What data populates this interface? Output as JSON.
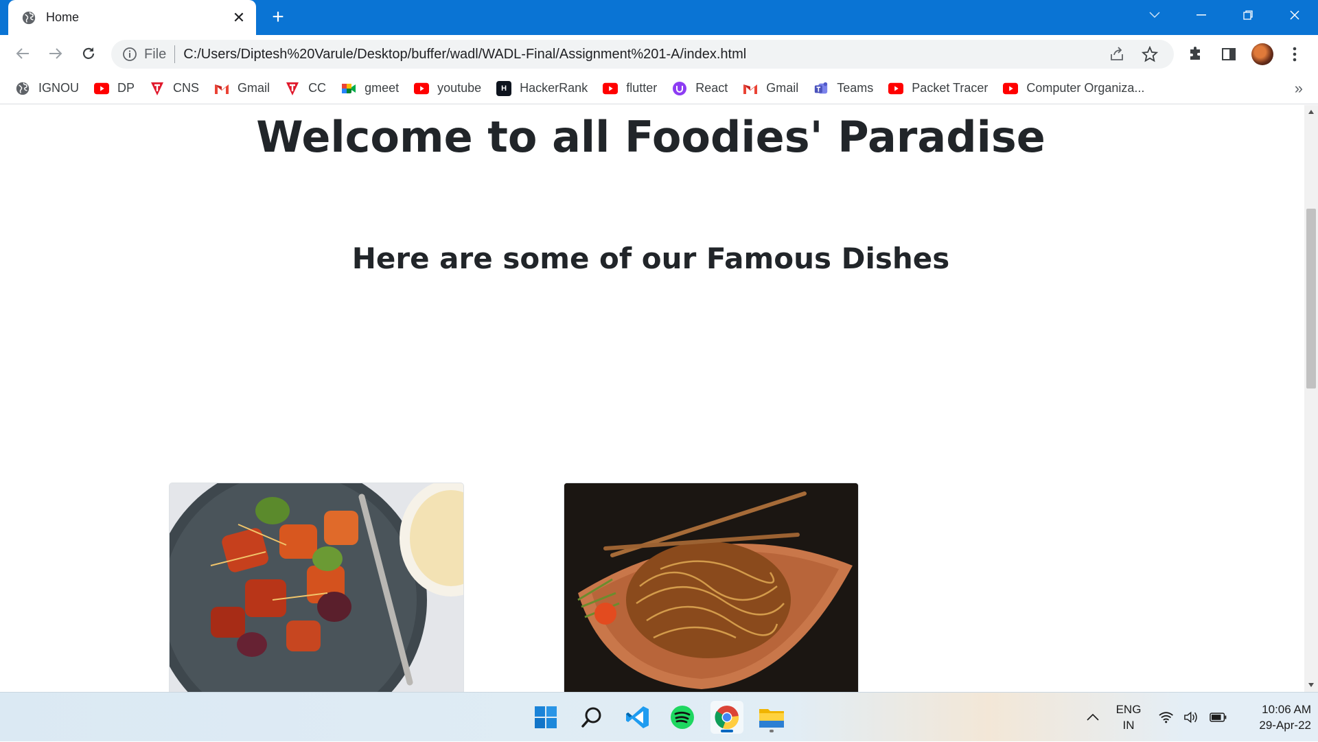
{
  "browser": {
    "tab": {
      "title": "Home",
      "favicon": "globe-icon"
    },
    "omnibox": {
      "scheme_label": "File",
      "url": "C:/Users/Diptesh%20Varule/Desktop/buffer/wadl/WADL-Final/Assignment%201-A/index.html"
    },
    "bookmarks": [
      {
        "label": "IGNOU",
        "icon": "globe-icon"
      },
      {
        "label": "DP",
        "icon": "youtube-icon"
      },
      {
        "label": "CNS",
        "icon": "t-icon"
      },
      {
        "label": "Gmail",
        "icon": "gmail-icon"
      },
      {
        "label": "CC",
        "icon": "t-icon"
      },
      {
        "label": "gmeet",
        "icon": "meet-icon"
      },
      {
        "label": "youtube",
        "icon": "youtube-icon"
      },
      {
        "label": "HackerRank",
        "icon": "hackerrank-icon"
      },
      {
        "label": "flutter",
        "icon": "youtube-icon"
      },
      {
        "label": "React",
        "icon": "react-icon"
      },
      {
        "label": "Gmail",
        "icon": "gmail-icon"
      },
      {
        "label": "Teams",
        "icon": "teams-icon"
      },
      {
        "label": "Packet Tracer",
        "icon": "youtube-icon"
      },
      {
        "label": "Computer Organiza...",
        "icon": "youtube-icon"
      }
    ],
    "bookmarks_overflow": "»"
  },
  "page": {
    "heading_before": "Welcome to all ",
    "heading_bold": "Foodies'",
    "heading_after": " Paradise",
    "subheading": "Here are some of our Famous Dishes",
    "dishes": [
      {
        "image": "paneer-chilli-photo"
      },
      {
        "image": "hakka-noodles-photo"
      }
    ]
  },
  "taskbar": {
    "apps": [
      "windows-start-icon",
      "search-icon",
      "vscode-icon",
      "spotify-icon",
      "chrome-icon",
      "file-explorer-icon"
    ],
    "language_line1": "ENG",
    "language_line2": "IN",
    "time": "10:06 AM",
    "date": "29-Apr-22"
  },
  "colors": {
    "titlebar": "#0a74d4",
    "text": "#212529",
    "youtube": "#ff0000"
  }
}
